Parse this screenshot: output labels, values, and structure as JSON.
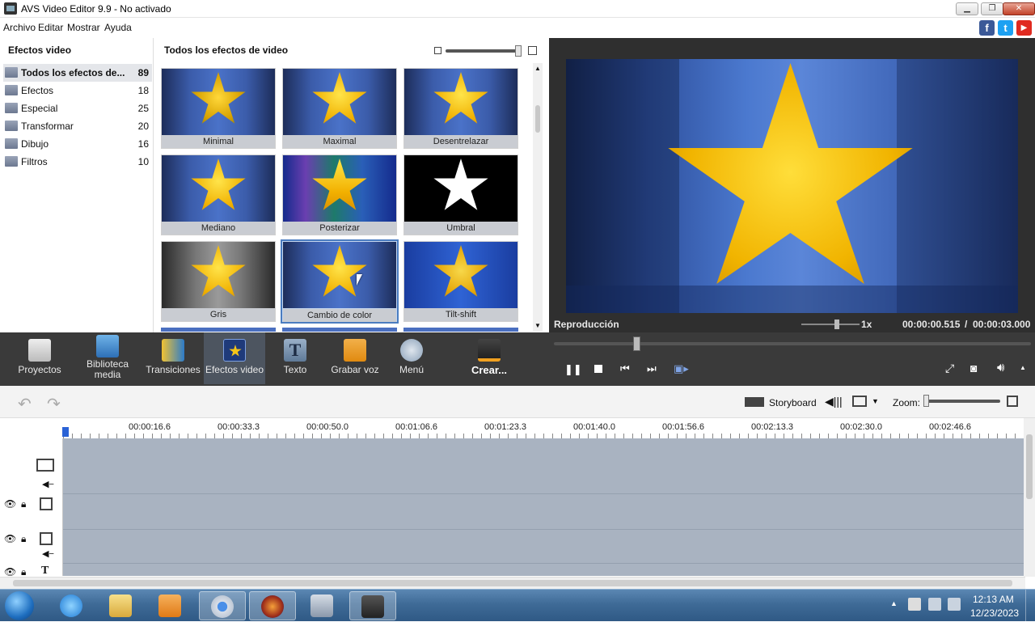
{
  "window": {
    "title": "AVS Video Editor 9.9 - No activado"
  },
  "menu": [
    "Archivo",
    "Editar",
    "Mostrar",
    "Ayuda"
  ],
  "social": [
    "f",
    "t",
    "▶"
  ],
  "left_panel": {
    "title": "Efectos video",
    "categories": [
      {
        "label": "Todos los efectos de...",
        "count": "89"
      },
      {
        "label": "Efectos",
        "count": "18"
      },
      {
        "label": "Especial",
        "count": "25"
      },
      {
        "label": "Transformar",
        "count": "20"
      },
      {
        "label": "Dibujo",
        "count": "16"
      },
      {
        "label": "Filtros",
        "count": "10"
      }
    ]
  },
  "grid_panel": {
    "title": "Todos los efectos de video",
    "effects": [
      "Minimal",
      "Maximal",
      "Desentrelazar",
      "Mediano",
      "Posterizar",
      "Umbral",
      "Gris",
      "Cambio de color",
      "Tilt-shift"
    ]
  },
  "preview": {
    "label": "Reproducción",
    "speed": "1x",
    "time_current": "00:00:00.515",
    "separator": "/",
    "time_total": "00:00:03.000"
  },
  "toolbar": [
    {
      "label": "Proyectos"
    },
    {
      "label": "Biblioteca\nmedia"
    },
    {
      "label": "Transiciones"
    },
    {
      "label": "Efectos video"
    },
    {
      "label": "Texto"
    },
    {
      "label": "Grabar voz"
    },
    {
      "label": "Menú"
    },
    {
      "label": "Crear..."
    }
  ],
  "timeline": {
    "storyboard": "Storyboard",
    "zoom": "Zoom:",
    "ticks": [
      "00:00:16.6",
      "00:00:33.3",
      "00:00:50.0",
      "00:01:06.6",
      "00:01:23.3",
      "00:01:40.0",
      "00:01:56.6",
      "00:02:13.3",
      "00:02:30.0",
      "00:02:46.6"
    ]
  },
  "taskbar": {
    "time": "12:13 AM",
    "date": "12/23/2023"
  }
}
